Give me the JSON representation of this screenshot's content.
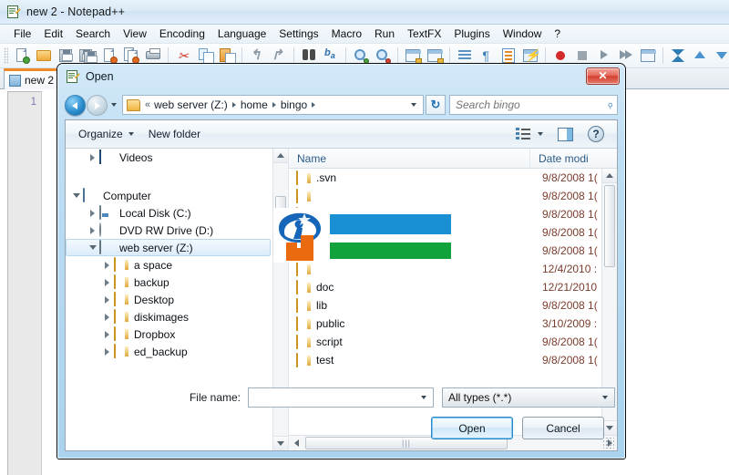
{
  "app": {
    "title": "new 2 - Notepad++",
    "icon": "notepad-plus-plus-icon",
    "menu": [
      "File",
      "Edit",
      "Search",
      "View",
      "Encoding",
      "Language",
      "Settings",
      "Macro",
      "Run",
      "TextFX",
      "Plugins",
      "Window",
      "?"
    ],
    "tab": {
      "label": "new 2"
    },
    "editor": {
      "line_number": "1"
    }
  },
  "dialog": {
    "title": "Open",
    "close_label": "✕",
    "address": {
      "chevrons": "«",
      "segments": [
        "web server (Z:)",
        "home",
        "bingo"
      ]
    },
    "search": {
      "placeholder": "Search bingo",
      "value": ""
    },
    "refresh_label": "↻",
    "commandbar": {
      "organize": "Organize",
      "new_folder": "New folder"
    },
    "navigation": [
      {
        "label": "Videos",
        "icon": "video-icon",
        "indent": 1,
        "expander": "closed",
        "selected": false
      },
      {
        "label": "",
        "icon": "none",
        "indent": 1,
        "expander": "none",
        "selected": false
      },
      {
        "label": "Computer",
        "icon": "computer-icon",
        "indent": 0,
        "expander": "open",
        "selected": false
      },
      {
        "label": "Local Disk (C:)",
        "icon": "disk-icon",
        "indent": 1,
        "expander": "closed",
        "selected": false
      },
      {
        "label": "DVD RW Drive (D:)",
        "icon": "dvd-icon",
        "indent": 1,
        "expander": "closed",
        "selected": false
      },
      {
        "label": "web server (Z:)",
        "icon": "network-drive-icon",
        "indent": 1,
        "expander": "open",
        "selected": true
      },
      {
        "label": "a space",
        "icon": "folder-icon",
        "indent": 2,
        "expander": "closed",
        "selected": false
      },
      {
        "label": "backup",
        "icon": "folder-icon",
        "indent": 2,
        "expander": "closed",
        "selected": false
      },
      {
        "label": "Desktop",
        "icon": "folder-icon",
        "indent": 2,
        "expander": "closed",
        "selected": false
      },
      {
        "label": "diskimages",
        "icon": "folder-icon",
        "indent": 2,
        "expander": "closed",
        "selected": false
      },
      {
        "label": "Dropbox",
        "icon": "folder-icon",
        "indent": 2,
        "expander": "closed",
        "selected": false
      },
      {
        "label": "ed_backup",
        "icon": "folder-icon",
        "indent": 2,
        "expander": "closed",
        "selected": false
      }
    ],
    "columns": {
      "name": "Name",
      "date": "Date modi"
    },
    "files": [
      {
        "name": ".svn",
        "date": "9/8/2008 1("
      },
      {
        "name": "",
        "date": "9/8/2008 1("
      },
      {
        "name": "",
        "date": "9/8/2008 1("
      },
      {
        "name": "",
        "date": "9/8/2008 1("
      },
      {
        "name": "",
        "date": "9/8/2008 1("
      },
      {
        "name": "",
        "date": "12/4/2010 :"
      },
      {
        "name": "doc",
        "date": "12/21/2010"
      },
      {
        "name": "lib",
        "date": "9/8/2008 1("
      },
      {
        "name": "public",
        "date": "3/10/2009 :"
      },
      {
        "name": "script",
        "date": "9/8/2008 1("
      },
      {
        "name": "test",
        "date": "9/8/2008 1("
      }
    ],
    "form": {
      "filename_label": "File name:",
      "filename_value": "",
      "filetype_value": "All types (*.*)"
    },
    "buttons": {
      "open": "Open",
      "cancel": "Cancel"
    }
  },
  "overlay": {
    "kind": "logo-watermark",
    "colors": {
      "blue": "#1b8fd4",
      "green": "#12a23c",
      "orange": "#ea6a10",
      "mark_blue": "#1565b8"
    }
  },
  "colors": {
    "dialog_frame": "#b8daf0",
    "title_accent": "#f08a24",
    "close_red": "#d2402f",
    "column_header_text": "#2b5a86",
    "date_text": "#7a3c2d"
  }
}
